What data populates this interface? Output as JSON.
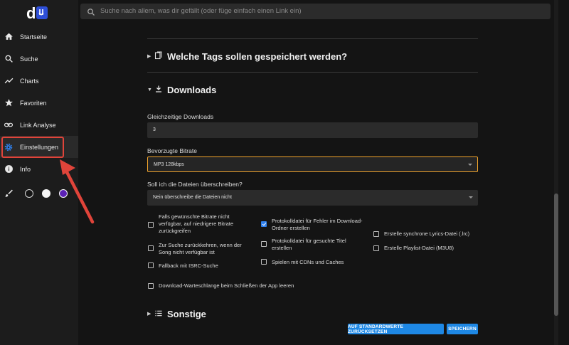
{
  "logo": {
    "text": "d"
  },
  "sidebar": {
    "items": [
      {
        "label": "Startseite",
        "icon": "home-icon"
      },
      {
        "label": "Suche",
        "icon": "search-icon"
      },
      {
        "label": "Charts",
        "icon": "trending-icon"
      },
      {
        "label": "Favoriten",
        "icon": "star-icon"
      },
      {
        "label": "Link Analyse",
        "icon": "link-icon"
      },
      {
        "label": "Einstellungen",
        "icon": "gear-icon",
        "active": true
      },
      {
        "label": "Info",
        "icon": "info-icon"
      }
    ],
    "theme": {
      "icon": "brush-icon",
      "colors": [
        "#141414",
        "#f5f5f5",
        "#5b21b6"
      ]
    }
  },
  "search": {
    "placeholder": "Suche nach allem, was dir gefällt (oder füge einfach einen Link ein)"
  },
  "sections": {
    "tags": {
      "title": "Welche Tags sollen gespeichert werden?",
      "icon": "bookmark-icon",
      "state": "collapsed"
    },
    "downloads": {
      "title": "Downloads",
      "icon": "download-icon",
      "state": "expanded"
    },
    "other": {
      "title": "Sonstige",
      "icon": "list-icon",
      "state": "collapsed"
    }
  },
  "downloads": {
    "concurrent_label": "Gleichzeitige Downloads",
    "concurrent_value": "3",
    "bitrate_label": "Bevorzugte Bitrate",
    "bitrate_value": "MP3 128kbps",
    "overwrite_label": "Soll ich die Dateien überschreiben?",
    "overwrite_value": "Nein überschreibe die Dateien nicht",
    "checkboxes": [
      {
        "label": "Falls gewünschte Bitrate nicht verfügbar, auf niedrigere Bitrate zurückgreifen",
        "checked": false
      },
      {
        "label": "Zur Suche zurückkehren, wenn der Song nicht verfügbar ist",
        "checked": false
      },
      {
        "label": "Fallback mit ISRC-Suche",
        "checked": false
      },
      {
        "label": "Protokolldatei für Fehler im Download-Ordner erstellen",
        "checked": true
      },
      {
        "label": "Protokolldatei für gesuchte Titel erstellen",
        "checked": false
      },
      {
        "label": "Spielen mit CDNs und Caches",
        "checked": false
      },
      {
        "label": "Erstelle synchrone Lyrics-Datei (.lrc)",
        "checked": false
      },
      {
        "label": "Erstelle Playlist-Datei (M3U8)",
        "checked": false
      },
      {
        "label": "Download-Warteschlange beim Schließen der App leeren",
        "checked": false
      }
    ]
  },
  "buttons": {
    "reset": "AUF STANDARDWERTE ZURÜCKSETZEN",
    "save": "SPEICHERN"
  },
  "colors": {
    "accent": "#1e88e5",
    "focus": "#f0a32b",
    "highlight": "#e0443a"
  }
}
